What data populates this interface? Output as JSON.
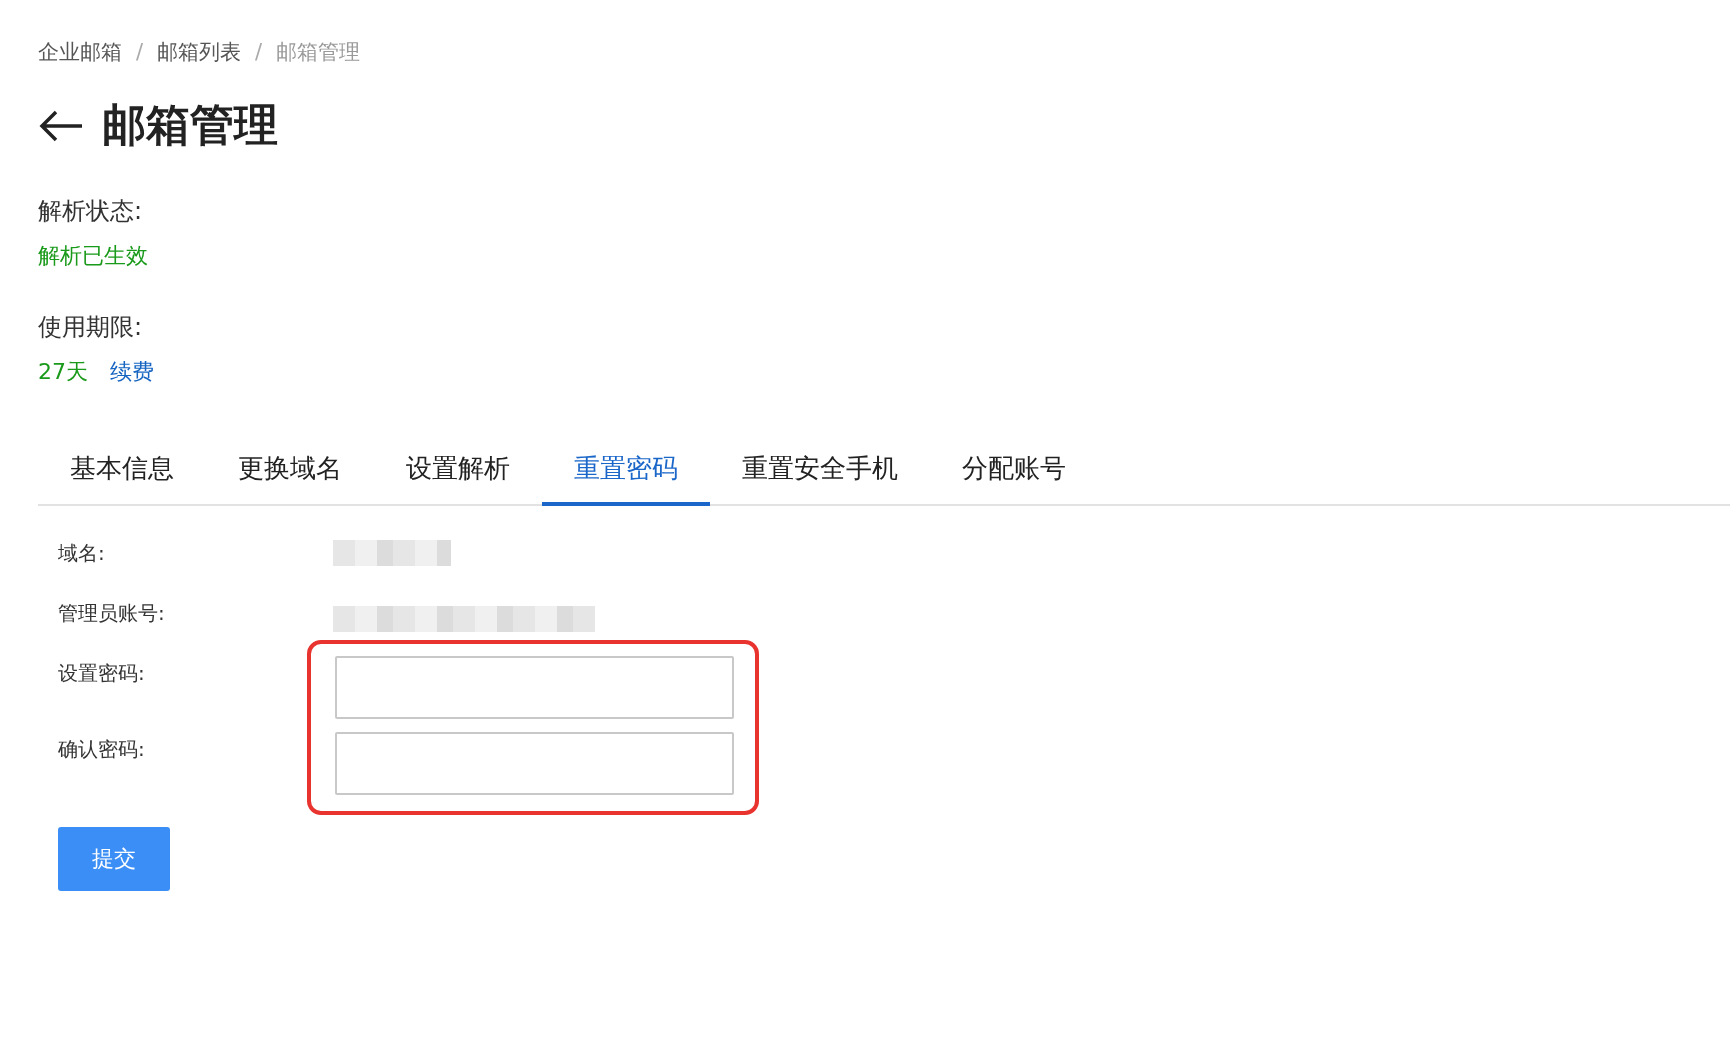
{
  "breadcrumb": [
    {
      "label": "企业邮箱",
      "current": false
    },
    {
      "label": "邮箱列表",
      "current": false
    },
    {
      "label": "邮箱管理",
      "current": true
    }
  ],
  "breadcrumb_separator": "/",
  "title": "邮箱管理",
  "info": [
    {
      "label": "解析状态:",
      "values": [
        {
          "text": "解析已生效",
          "kind": "status"
        }
      ]
    },
    {
      "label": "使用期限:",
      "values": [
        {
          "text": "27天",
          "kind": "status"
        },
        {
          "text": "续费",
          "kind": "link"
        }
      ]
    }
  ],
  "tabs": [
    {
      "label": "基本信息",
      "selected": false
    },
    {
      "label": "更换域名",
      "selected": false
    },
    {
      "label": "设置解析",
      "selected": false
    },
    {
      "label": "重置密码",
      "selected": true
    },
    {
      "label": "重置安全手机",
      "selected": false
    },
    {
      "label": "分配账号",
      "selected": false
    }
  ],
  "form": [
    {
      "label": "域名:",
      "kind": "redacted"
    },
    {
      "label": "管理员账号:",
      "kind": "redacted"
    },
    {
      "label": "设置密码:",
      "kind": "input"
    },
    {
      "label": "确认密码:",
      "kind": "input"
    }
  ],
  "submit": "提交"
}
